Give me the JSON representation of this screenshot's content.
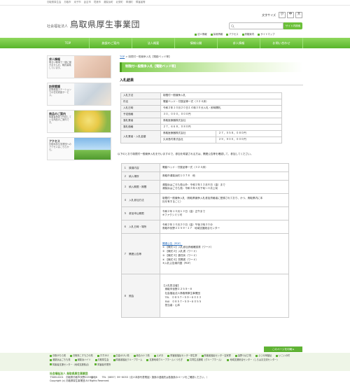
{
  "topbar": {
    "links": [
      "鳥取県厚生会",
      "鳥取市",
      "米子市",
      "倉吉市",
      "境港市",
      "湯梨浜町",
      "北栄町",
      "琴浦町",
      "障害者等"
    ]
  },
  "header": {
    "logo_sub": "社会福祉法人",
    "logo_main": "鳥取県厚生事業団",
    "font_size_label": "文字サイズ",
    "font_sizes": [
      "小",
      "中",
      "大"
    ],
    "search_button": "サイト内検索",
    "links": [
      "法人情報",
      "採用情報",
      "アクセス",
      "資格案内",
      "サイトマップ"
    ]
  },
  "nav": [
    "TOP",
    "施設のご案内",
    "法人概要",
    "情報公開",
    "求人情報",
    "お問い合わせ"
  ],
  "sidebar": [
    {
      "title": "求人情報",
      "desc": "明るい職場で一緒に働きませんか。職員募集しています。"
    },
    {
      "title": "訪問看護",
      "desc": "訪問看護ステーションでの在宅看護サービス。"
    },
    {
      "title": "商品のご案内",
      "desc": "障害者施設で作成している商品のご案内です。"
    },
    {
      "title": "アクセス",
      "desc": "鳥取県厚生事業団へのアクセスはこちらから。"
    }
  ],
  "breadcrumb": {
    "top": "TOP",
    "sep": " > ",
    "current": "制限付一般競争入札【電動ベッド等】"
  },
  "page_title": "制限付一般競争入札【電動ベッド等】",
  "section_title": "入札結果",
  "result_rows": [
    {
      "k": "入札方法",
      "v": "制限付一般競争入札"
    },
    {
      "k": "件名",
      "v": "電動ベッド・付属品等一式（３２４床）"
    },
    {
      "k": "入札日時",
      "v": "令和２年１０月２０日１４時３０分入札・即時開札"
    },
    {
      "k": "予定価格",
      "v": "３０，０００，０００円"
    },
    {
      "k": "落札業者",
      "v": "鳥取医療器株式会社"
    },
    {
      "k": "落札価格",
      "v": "２７，６６８，０８０円"
    }
  ],
  "bidders": {
    "label": "入札業者・入札金額",
    "rows": [
      {
        "name": "鳥取医療器株式会社",
        "amount": "２７，５５８，０８０円"
      },
      {
        "name": "久米島村株式会社",
        "amount": "２９，９００，０００円"
      }
    ]
  },
  "intro": "以下のとおり制限付一般競争入札を行いますので、参加を希望される方は、関連公告等を確認して、参加してください。",
  "info_rows": [
    {
      "n": "１　調達内容",
      "v": [
        "電動ベッド・付属品等一式（３２４床）"
      ]
    },
    {
      "n": "２　納入場所",
      "v": [
        "鳥取市湯梨浜町１０７８　他"
      ]
    },
    {
      "n": "３　納入期限・期間",
      "v": [
        "湯梨浜はごろも苑以外：令和２年１２月８日（金）まで",
        "湯梨浜はごろも苑：令和３年２月下旬〜３月上旬"
      ]
    },
    {
      "n": "４　入札参加方法",
      "v": [
        "制限付一般競争入札（鳥取県競争入札参加資格者に登録されており、かつ、鳥取県内に本",
        "社を有すること）"
      ]
    },
    {
      "n": "５　参加申込期限",
      "v": [
        "令和２年１０月１３日（金）正午まで",
        "※ファクシミリ可"
      ]
    },
    {
      "n": "６　入札日時・場所",
      "v": [
        "令和２年１０月２０日（金）午後２時３０分",
        "鳥取市伏野２２５９−１７　地域支援総合センター"
      ]
    }
  ],
  "docs": {
    "n": "７　関連公告等",
    "link": "関連公告（PDF）",
    "items": [
      "① 【様式１】入札参加資格確認書（ワード）",
      "② 【様式２】入札書（ワード）",
      "③ 【様式３】委任状（ワード）",
      "④ 【様式４】質問書（ワード）",
      "⑤入札公告案内図（PDF）"
    ]
  },
  "contact": {
    "n": "８　照会",
    "lines": [
      "【入札担当者】",
      "　鳥取市伏野２２５９−８",
      "　社会福祉法人鳥取県厚生事業団",
      "　TEL　０８５７−５９−６０３３",
      "　FAX　０８５７−５９−６０５５",
      "　担当者：山本"
    ]
  },
  "share_button": "このページを印刷 ▸",
  "footer": {
    "links": [
      "鳥取がらら苑",
      "鳥取県こすもさの苑",
      "すずかけ",
      "白金かけい苑",
      "総合カナコ苑",
      "えがお",
      "障害者福祉センター厚生寮",
      "障害者福祉センター吉家寮",
      "皆野つばさ苑",
      "ふじの岡福祉",
      "いこいの村",
      "湯梨浜はごろも苑",
      "湯梨浜ハイツ",
      "鳥取厚生会",
      "障害者福祉クループホーム",
      "支援地域グループホームくつろぎ",
      "共同生活援助（グループホーム）",
      "地域支援総合センター（しらはま交流センター）",
      "障害者支援センター（地域支援拠点）",
      "障害者作業所"
    ],
    "org": "社会福祉法人 鳥取県厚生事業団",
    "address": "〒689-0201　鳥取県鳥取市伏野2259番地8　　TEL（0857）59−6033（法人本部代表電話）施設の連絡先は各施設のページをご確認ください。）",
    "copyright": "Copyright (c) 鳥取県厚生事業団 All Rights Reserved."
  },
  "colors": {
    "accent": "#5fb234",
    "nav_top": "#8fd85c",
    "link": "#2a6fbf"
  }
}
